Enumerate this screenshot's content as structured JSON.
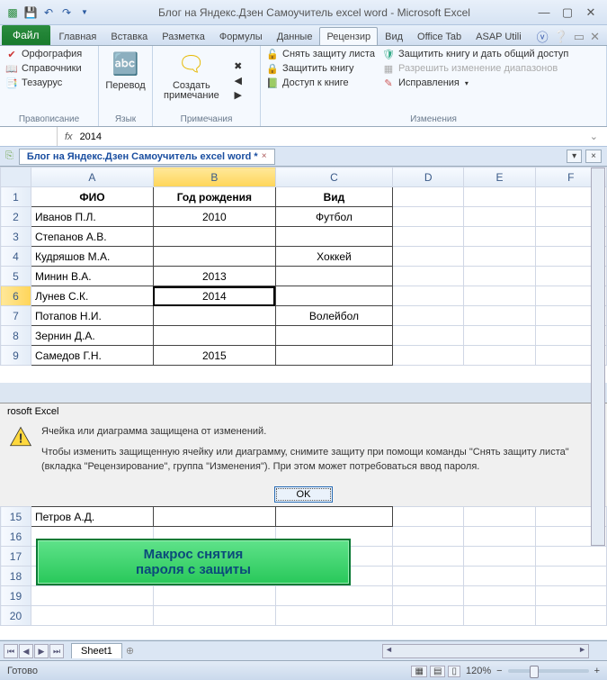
{
  "titlebar": {
    "title": "Блог на Яндекс.Дзен Самоучитель excel word  -  Microsoft Excel"
  },
  "tabs": {
    "file": "Файл",
    "items": [
      "Главная",
      "Вставка",
      "Разметка",
      "Формулы",
      "Данные",
      "Рецензир",
      "Вид",
      "Office Tab",
      "ASAP Utili"
    ],
    "active_index": 5
  },
  "ribbon": {
    "proofing": {
      "label": "Правописание",
      "spelling": "Орфография",
      "research": "Справочники",
      "thesaurus": "Тезаурус"
    },
    "language": {
      "label": "Язык",
      "translate": "Перевод"
    },
    "comments": {
      "label": "Примечания",
      "new": "Создать",
      "new2": "примечание"
    },
    "changes": {
      "label": "Изменения",
      "unprotect_sheet": "Снять защиту листа",
      "protect_book": "Защитить книгу",
      "share_book": "Доступ к книге",
      "protect_share": "Защитить книгу и дать общий доступ",
      "allow_ranges": "Разрешить изменение диапазонов",
      "track": "Исправления"
    }
  },
  "formula_bar": {
    "value": "2014"
  },
  "workbook_tab": {
    "name": "Блог на Яндекс.Дзен Самоучитель excel word *"
  },
  "columns": [
    "A",
    "B",
    "C",
    "D",
    "E",
    "F"
  ],
  "colwidths": [
    "120",
    "120",
    "115",
    "70",
    "70",
    "70"
  ],
  "headers": {
    "A": "ФИО",
    "B": "Год рождения",
    "C": "Вид"
  },
  "rows": [
    {
      "n": 1
    },
    {
      "n": 2,
      "A": "Иванов П.Л.",
      "B": "2010",
      "C": "Футбол"
    },
    {
      "n": 3,
      "A": "Степанов А.В."
    },
    {
      "n": 4,
      "A": "Кудряшов М.А.",
      "C": "Хоккей"
    },
    {
      "n": 5,
      "A": "Минин В.А.",
      "B": "2013"
    },
    {
      "n": 6,
      "A": "Лунев С.К.",
      "B": "2014"
    },
    {
      "n": 7,
      "A": "Потапов Н.И.",
      "C": "Волейбол"
    },
    {
      "n": 8,
      "A": "Зернин Д.А."
    },
    {
      "n": 9,
      "A": "Самедов Г.Н.",
      "B": "2015"
    }
  ],
  "lower_rows": [
    {
      "n": 15,
      "A": "Петров А.Д."
    },
    {
      "n": 16
    },
    {
      "n": 17
    },
    {
      "n": 18
    },
    {
      "n": 19
    },
    {
      "n": 20
    }
  ],
  "macro": {
    "line1": "Макрос снятия",
    "line2": "пароля с защиты"
  },
  "dialog": {
    "title": "rosoft Excel",
    "line1": "Ячейка или диаграмма защищена от изменений.",
    "line2": "Чтобы изменить защищенную ячейку или диаграмму, снимите защиту при помощи команды \"Снять защиту листа\" (вкладка \"Рецензирование\", группа \"Изменения\"). При этом может потребоваться ввод пароля.",
    "ok": "OK"
  },
  "sheetbar": {
    "sheet": "Sheet1"
  },
  "statusbar": {
    "ready": "Готово",
    "zoom": "120%"
  }
}
